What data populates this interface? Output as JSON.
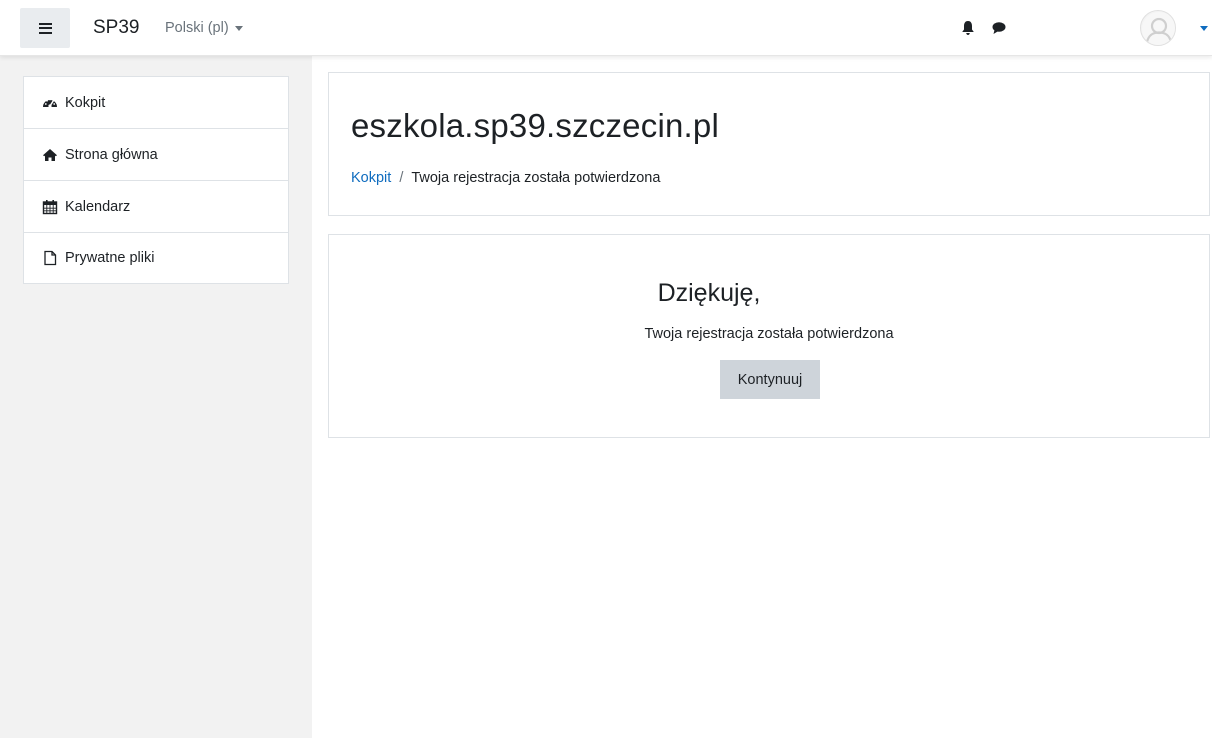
{
  "navbar": {
    "brand": "SP39",
    "language": "Polski (pl)",
    "icons": [
      "hamburger-icon",
      "bell-icon",
      "chat-icon",
      "user-avatar"
    ]
  },
  "sidebar": {
    "items": [
      {
        "label": "Kokpit",
        "icon": "dashboard-icon"
      },
      {
        "label": "Strona główna",
        "icon": "home-icon"
      },
      {
        "label": "Kalendarz",
        "icon": "calendar-icon"
      },
      {
        "label": "Prywatne pliki",
        "icon": "file-icon"
      }
    ]
  },
  "header": {
    "site_title": "eszkola.sp39.szczecin.pl",
    "breadcrumb": {
      "home": "Kokpit",
      "separator": "/",
      "current": "Twoja rejestracja została potwierdzona"
    }
  },
  "content": {
    "greeting": "Dziękuję,",
    "message": "Twoja rejestracja została potwierdzona",
    "continue_label": "Kontynuuj"
  },
  "colors": {
    "link": "#0f6cbf",
    "sidebar_bg": "#f2f2f2",
    "button_bg": "#ced4da"
  }
}
